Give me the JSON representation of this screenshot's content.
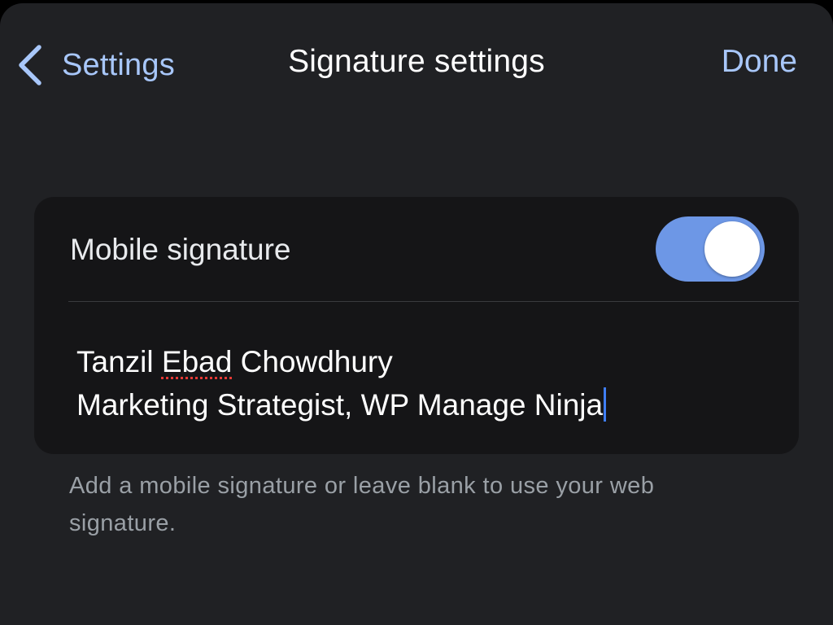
{
  "navbar": {
    "back_label": "Settings",
    "title": "Signature settings",
    "done_label": "Done"
  },
  "mobile_signature": {
    "label": "Mobile signature",
    "enabled": true
  },
  "signature": {
    "first_name": "Tanzil",
    "middle_name": "Ebad",
    "last_name": "Chowdhury",
    "line2": "Marketing Strategist, WP Manage Ninja"
  },
  "helper_text": "Add a mobile signature or leave blank to use your web signature.",
  "colors": {
    "accent": "#a8c7fa",
    "switch_on": "#6d97e6",
    "caret": "#3f7ef5",
    "background": "#202124",
    "card": "#151517"
  }
}
